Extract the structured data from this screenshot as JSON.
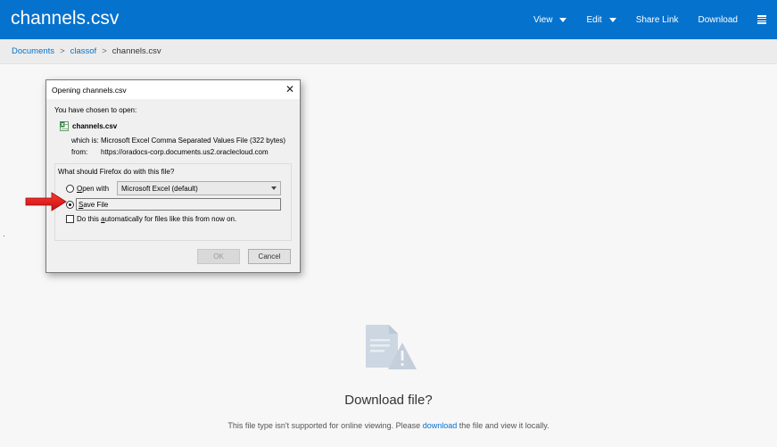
{
  "header": {
    "title": "channels.csv",
    "nav": [
      {
        "label": "View",
        "has_caret": true
      },
      {
        "label": "Edit",
        "has_caret": true
      },
      {
        "label": "Share Link",
        "has_caret": false
      },
      {
        "label": "Download",
        "has_caret": false
      }
    ],
    "menu_icon": "hamburger-icon"
  },
  "breadcrumb": {
    "items": [
      "Documents",
      "classof"
    ],
    "separator": ">",
    "current": "channels.csv"
  },
  "dialog": {
    "title": "Opening channels.csv",
    "close_glyph": "✕",
    "chosen_label": "You have chosen to open:",
    "file_name": "channels.csv",
    "which_label": "which is:",
    "which_value": "Microsoft Excel Comma Separated Values File (322 bytes)",
    "from_label": "from:",
    "from_value": "https://oradocs-corp.documents.us2.oraclecloud.com",
    "question": "What should Firefox do with this file?",
    "open_with_label": "Open with",
    "open_with_value": "Microsoft Excel (default)",
    "save_file_label": "Save File",
    "selected_option": "save_file",
    "auto_label": "Do this automatically for files like this from now on.",
    "auto_checked": false,
    "ok_label": "OK",
    "cancel_label": "Cancel"
  },
  "empty_state": {
    "title": "Download file?",
    "text_before": "This file type isn't supported for online viewing. Please ",
    "link_text": "download",
    "text_after": " the file and view it locally."
  },
  "colors": {
    "brand_blue": "#0572ce",
    "annotation_arrow": "#e8141b"
  }
}
